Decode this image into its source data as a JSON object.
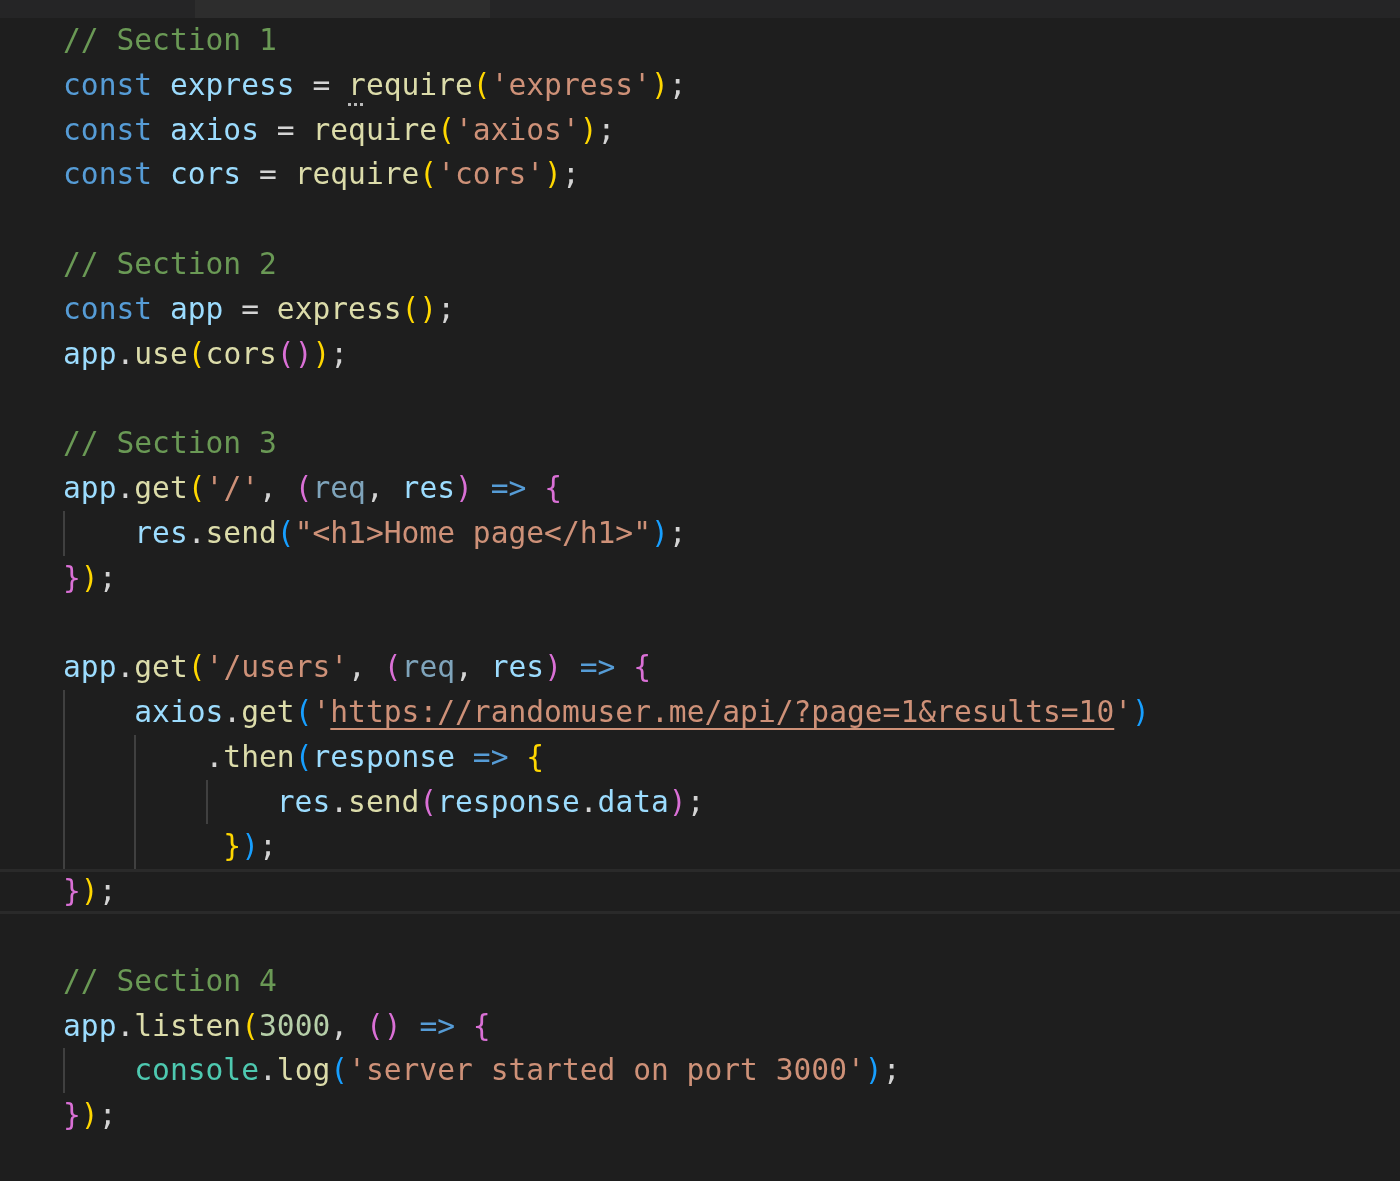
{
  "editor": {
    "lines": [
      {
        "current": false,
        "tokens": [
          {
            "kind": "comment",
            "text": "// Section 1"
          }
        ]
      },
      {
        "current": false,
        "tokens": [
          {
            "kind": "keyword",
            "text": "const "
          },
          {
            "kind": "var",
            "text": "express"
          },
          {
            "kind": "punct",
            "text": " = "
          },
          {
            "kind": "hint",
            "text": "r"
          },
          {
            "kind": "fn",
            "text": "equire"
          },
          {
            "kind": "b1",
            "text": "("
          },
          {
            "kind": "str",
            "text": "'express'"
          },
          {
            "kind": "b1",
            "text": ")"
          },
          {
            "kind": "punct",
            "text": ";"
          }
        ]
      },
      {
        "current": false,
        "tokens": [
          {
            "kind": "keyword",
            "text": "const "
          },
          {
            "kind": "var",
            "text": "axios"
          },
          {
            "kind": "punct",
            "text": " = "
          },
          {
            "kind": "fn",
            "text": "require"
          },
          {
            "kind": "b1",
            "text": "("
          },
          {
            "kind": "str",
            "text": "'axios'"
          },
          {
            "kind": "b1",
            "text": ")"
          },
          {
            "kind": "punct",
            "text": ";"
          }
        ]
      },
      {
        "current": false,
        "tokens": [
          {
            "kind": "keyword",
            "text": "const "
          },
          {
            "kind": "var",
            "text": "cors"
          },
          {
            "kind": "punct",
            "text": " = "
          },
          {
            "kind": "fn",
            "text": "require"
          },
          {
            "kind": "b1",
            "text": "("
          },
          {
            "kind": "str",
            "text": "'cors'"
          },
          {
            "kind": "b1",
            "text": ")"
          },
          {
            "kind": "punct",
            "text": ";"
          }
        ]
      },
      {
        "current": false
      },
      {
        "current": false,
        "tokens": [
          {
            "kind": "comment",
            "text": "// Section 2"
          }
        ]
      },
      {
        "current": false,
        "tokens": [
          {
            "kind": "keyword",
            "text": "const "
          },
          {
            "kind": "var",
            "text": "app"
          },
          {
            "kind": "punct",
            "text": " = "
          },
          {
            "kind": "fn",
            "text": "express"
          },
          {
            "kind": "b1",
            "text": "()"
          },
          {
            "kind": "punct",
            "text": ";"
          }
        ]
      },
      {
        "current": false,
        "tokens": [
          {
            "kind": "var",
            "text": "app"
          },
          {
            "kind": "punct",
            "text": "."
          },
          {
            "kind": "fn",
            "text": "use"
          },
          {
            "kind": "b1",
            "text": "("
          },
          {
            "kind": "fn",
            "text": "cors"
          },
          {
            "kind": "b2",
            "text": "()"
          },
          {
            "kind": "b1",
            "text": ")"
          },
          {
            "kind": "punct",
            "text": ";"
          }
        ]
      },
      {
        "current": false
      },
      {
        "current": false,
        "tokens": [
          {
            "kind": "comment",
            "text": "// Section 3"
          }
        ]
      },
      {
        "current": false,
        "tokens": [
          {
            "kind": "var",
            "text": "app"
          },
          {
            "kind": "punct",
            "text": "."
          },
          {
            "kind": "fn",
            "text": "get"
          },
          {
            "kind": "b1",
            "text": "("
          },
          {
            "kind": "str",
            "text": "'/'"
          },
          {
            "kind": "punct",
            "text": ", "
          },
          {
            "kind": "b2",
            "text": "("
          },
          {
            "kind": "param",
            "text": "req"
          },
          {
            "kind": "punct",
            "text": ", "
          },
          {
            "kind": "var",
            "text": "res"
          },
          {
            "kind": "b2",
            "text": ") "
          },
          {
            "kind": "keyword",
            "text": "=> "
          },
          {
            "kind": "b2",
            "text": "{"
          }
        ]
      },
      {
        "current": false,
        "tokens": [
          {
            "kind": "var",
            "text": "    res"
          },
          {
            "kind": "punct",
            "text": "."
          },
          {
            "kind": "fn",
            "text": "send"
          },
          {
            "kind": "b3",
            "text": "("
          },
          {
            "kind": "str",
            "text": "\"<h1>Home page</h1>\""
          },
          {
            "kind": "b3",
            "text": ")"
          },
          {
            "kind": "punct",
            "text": ";"
          }
        ]
      },
      {
        "current": false,
        "tokens": [
          {
            "kind": "b2",
            "text": "}"
          },
          {
            "kind": "b1",
            "text": ")"
          },
          {
            "kind": "punct",
            "text": ";"
          }
        ]
      },
      {
        "current": false
      },
      {
        "current": false,
        "tokens": [
          {
            "kind": "var",
            "text": "app"
          },
          {
            "kind": "punct",
            "text": "."
          },
          {
            "kind": "fn",
            "text": "get"
          },
          {
            "kind": "b1",
            "text": "("
          },
          {
            "kind": "str",
            "text": "'/users'"
          },
          {
            "kind": "punct",
            "text": ", "
          },
          {
            "kind": "b2",
            "text": "("
          },
          {
            "kind": "param",
            "text": "req"
          },
          {
            "kind": "punct",
            "text": ", "
          },
          {
            "kind": "var",
            "text": "res"
          },
          {
            "kind": "b2",
            "text": ") "
          },
          {
            "kind": "keyword",
            "text": "=> "
          },
          {
            "kind": "b2",
            "text": "{"
          }
        ]
      },
      {
        "current": false,
        "tokens": [
          {
            "kind": "var",
            "text": "    axios"
          },
          {
            "kind": "punct",
            "text": "."
          },
          {
            "kind": "fn",
            "text": "get"
          },
          {
            "kind": "b3",
            "text": "("
          },
          {
            "kind": "str",
            "text": "'"
          },
          {
            "kind": "link",
            "text": "https://randomuser.me/api/?page=1&results=10"
          },
          {
            "kind": "str",
            "text": "'"
          },
          {
            "kind": "b3",
            "text": ")"
          }
        ]
      },
      {
        "current": false,
        "tokens": [
          {
            "kind": "punct",
            "text": "        ."
          },
          {
            "kind": "fn",
            "text": "then"
          },
          {
            "kind": "b3",
            "text": "("
          },
          {
            "kind": "var",
            "text": "response "
          },
          {
            "kind": "keyword",
            "text": "=> "
          },
          {
            "kind": "b1",
            "text": "{"
          }
        ]
      },
      {
        "current": false,
        "tokens": [
          {
            "kind": "var",
            "text": "            res"
          },
          {
            "kind": "punct",
            "text": "."
          },
          {
            "kind": "fn",
            "text": "send"
          },
          {
            "kind": "b2",
            "text": "("
          },
          {
            "kind": "var",
            "text": "response"
          },
          {
            "kind": "punct",
            "text": "."
          },
          {
            "kind": "var",
            "text": "data"
          },
          {
            "kind": "b2",
            "text": ")"
          },
          {
            "kind": "punct",
            "text": ";"
          }
        ]
      },
      {
        "current": false,
        "tokens": [
          {
            "kind": "b1",
            "text": "         }"
          },
          {
            "kind": "b3",
            "text": ")"
          },
          {
            "kind": "punct",
            "text": ";"
          }
        ]
      },
      {
        "current": true,
        "tokens": [
          {
            "kind": "b2",
            "text": "}"
          },
          {
            "kind": "b1",
            "text": ")"
          },
          {
            "kind": "punct",
            "text": ";"
          }
        ]
      },
      {
        "current": false
      },
      {
        "current": false,
        "tokens": [
          {
            "kind": "comment",
            "text": "// Section 4"
          }
        ]
      },
      {
        "current": false,
        "tokens": [
          {
            "kind": "var",
            "text": "app"
          },
          {
            "kind": "punct",
            "text": "."
          },
          {
            "kind": "fn",
            "text": "listen"
          },
          {
            "kind": "b1",
            "text": "("
          },
          {
            "kind": "num",
            "text": "3000"
          },
          {
            "kind": "punct",
            "text": ", "
          },
          {
            "kind": "b2",
            "text": "() "
          },
          {
            "kind": "keyword",
            "text": "=> "
          },
          {
            "kind": "b2",
            "text": "{"
          }
        ]
      },
      {
        "current": false,
        "tokens": [
          {
            "kind": "class",
            "text": "    console"
          },
          {
            "kind": "punct",
            "text": "."
          },
          {
            "kind": "fn",
            "text": "log"
          },
          {
            "kind": "b3",
            "text": "("
          },
          {
            "kind": "str",
            "text": "'server started on port 3000'"
          },
          {
            "kind": "b3",
            "text": ")"
          },
          {
            "kind": "punct",
            "text": ";"
          }
        ]
      },
      {
        "current": false,
        "tokens": [
          {
            "kind": "b2",
            "text": "}"
          },
          {
            "kind": "b1",
            "text": ")"
          },
          {
            "kind": "punct",
            "text": ";"
          }
        ]
      }
    ]
  }
}
